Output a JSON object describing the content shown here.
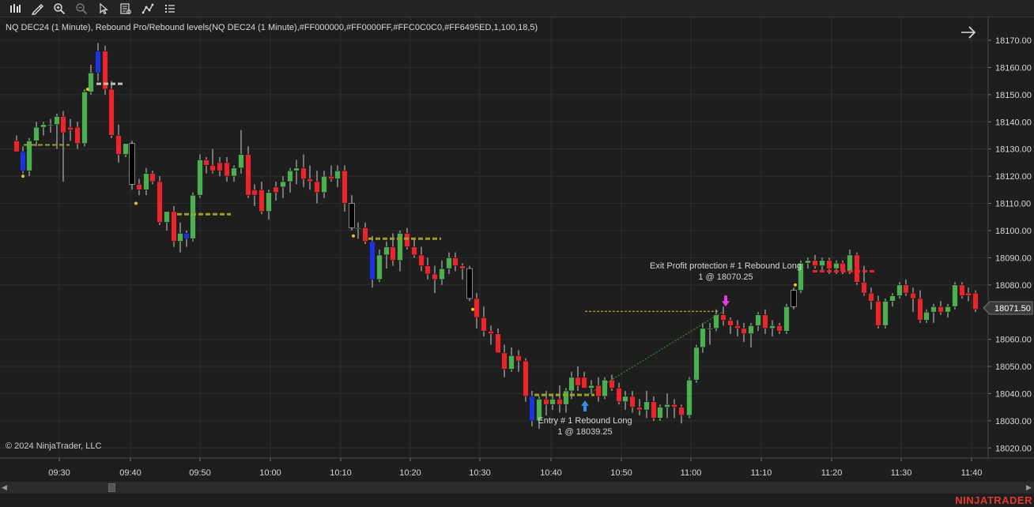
{
  "toolbar": {
    "items": [
      {
        "name": "bar-type-icon"
      },
      {
        "name": "drawing-tools-icon"
      },
      {
        "name": "zoom-in-icon"
      },
      {
        "name": "zoom-out-icon"
      },
      {
        "name": "pointer-icon"
      },
      {
        "name": "data-box-icon"
      },
      {
        "name": "indicators-icon"
      },
      {
        "name": "properties-icon"
      }
    ]
  },
  "chart": {
    "title": "NQ DEC24 (1 Minute), Rebound Pro/Rebound levels(NQ DEC24 (1 Minute),#FF000000,#FF0000FF,#FFC0C0C0,#FF6495ED,1,100,18,5)",
    "copyright": "© 2024 NinjaTrader, LLC",
    "price_labels": [
      "18170.00",
      "18160.00",
      "18150.00",
      "18140.00",
      "18130.00",
      "18120.00",
      "18110.00",
      "18100.00",
      "18090.00",
      "18080.00",
      "18060.00",
      "18050.00",
      "18040.00",
      "18030.00",
      "18020.00"
    ],
    "price_values": [
      18170,
      18160,
      18150,
      18140,
      18130,
      18120,
      18110,
      18100,
      18090,
      18080,
      18060,
      18050,
      18040,
      18030,
      18020
    ],
    "current_price": "18071.50",
    "current_value": 18071.5,
    "time_labels": [
      "09:30",
      "09:40",
      "09:50",
      "10:00",
      "10:10",
      "10:20",
      "10:30",
      "10:40",
      "10:50",
      "11:00",
      "11:10",
      "11:20",
      "11:30",
      "11:40"
    ],
    "annotations": {
      "exit_line1": "Exit Profit protection # 1 Rebound Long",
      "exit_line2": "1 @ 18070.25",
      "entry_line1": "Entry # 1 Rebound Long",
      "entry_line2": "1 @ 18039.25"
    },
    "colors": {
      "up": "#4caf50",
      "down": "#e8262b",
      "blue": "#1f34d8",
      "black": "#000000",
      "olive": "#a0a020",
      "silver": "#c0c0c0",
      "entry_arrow": "#3a8ee6",
      "exit_arrow": "#e040e0",
      "grid": "#2e2e2e"
    }
  },
  "brand": {
    "name": "NINJATRADER"
  }
}
